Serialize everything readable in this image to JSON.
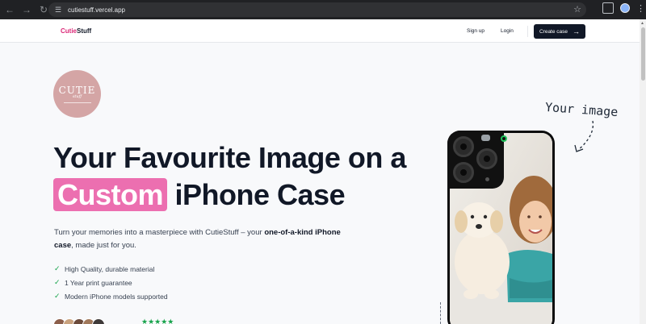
{
  "browser": {
    "url": "cutiestuff.vercel.app",
    "icons": [
      "back-icon",
      "forward-icon",
      "reload-icon",
      "site-info-icon",
      "bookmark-star-icon",
      "extensions-icon",
      "profile-icon",
      "menu-icon"
    ]
  },
  "header": {
    "logo_prefix": "Cutie",
    "logo_suffix": "Stuff",
    "signup_label": "Sign up",
    "login_label": "Login",
    "cta_label": "Create case"
  },
  "hero": {
    "badge_line1": "CUTIE",
    "badge_line2": "stuff",
    "title_part1": "Your Favourite Image on a",
    "title_highlight": "Custom",
    "title_part2": "iPhone Case",
    "subtitle_part1": "Turn your memories into a masterpiece with CutieStuff – your",
    "subtitle_bold1": "one-of-a-kind iPhone case",
    "subtitle_part2": ", made just for you.",
    "features": [
      "High Quality, durable material",
      "1 Year print guarantee",
      "Modern iPhone models supported"
    ],
    "stars": "★★★★★"
  },
  "mockup": {
    "annotation": "Your image"
  },
  "colors": {
    "accent": "#db2777",
    "highlight": "#ec6fb0",
    "check": "#16a34a",
    "dark": "#111827"
  }
}
